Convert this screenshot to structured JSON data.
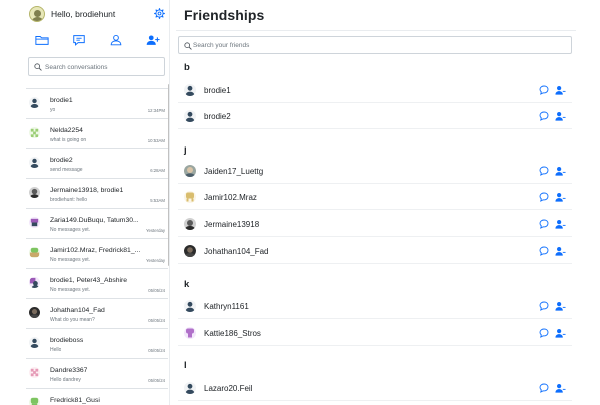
{
  "profile": {
    "greeting": "Hello, brodiehunt"
  },
  "icons": {
    "settings": "gear-icon",
    "conversations": "folder-icon",
    "messages": "chat-square-icon",
    "friends": "person-icon",
    "add_friend": "person-add-icon",
    "search": "search-icon",
    "message_friend": "chat-bubble-icon",
    "remove_friend": "person-remove-icon"
  },
  "colors": {
    "accent": "#0d6efd",
    "text": "#212529",
    "muted": "#6c757d",
    "border": "#dee2e6"
  },
  "search_conversations": {
    "placeholder": "Search conversations"
  },
  "conversations": [
    {
      "name": "brodie1",
      "message": "yo",
      "time": "12:34PM"
    },
    {
      "name": "Nelda2254",
      "message": "what is going on",
      "time": "10:53AM"
    },
    {
      "name": "brodie2",
      "message": "send message",
      "time": "6:28AM"
    },
    {
      "name": "Jermaine13918, brodie1",
      "message": "brodiehunt: hello",
      "time": "5:53AM"
    },
    {
      "name": "Zaria149.DuBuqu, Tatum30...",
      "message": "No messages yet.",
      "time": "Yesterday"
    },
    {
      "name": "Jamir102.Mraz, Fredrick81_...",
      "message": "No messages yet.",
      "time": "Yesterday"
    },
    {
      "name": "brodie1, Peter43_Abshire",
      "message": "No messages yet.",
      "time": "05/05/24"
    },
    {
      "name": "Johathan104_Fad",
      "message": "What do you mean?",
      "time": "05/05/24"
    },
    {
      "name": "brodieboss",
      "message": "Hello",
      "time": "05/05/24"
    },
    {
      "name": "Dandre3367",
      "message": "Hello dandrey",
      "time": "05/05/24"
    },
    {
      "name": "Fredrick81_Gusi",
      "message": "",
      "time": ""
    }
  ],
  "main": {
    "title": "Friendships",
    "search": {
      "placeholder": "Search your friends"
    },
    "groups": [
      {
        "letter": "b",
        "friends": [
          "brodie1",
          "brodie2"
        ]
      },
      {
        "letter": "j",
        "friends": [
          "Jaiden17_Luettg",
          "Jamir102.Mraz",
          "Jermaine13918",
          "Johathan104_Fad"
        ]
      },
      {
        "letter": "k",
        "friends": [
          "Kathryn1161",
          "Kattie186_Stros"
        ]
      },
      {
        "letter": "l",
        "friends": [
          "Lazaro20.Feil"
        ]
      }
    ]
  }
}
